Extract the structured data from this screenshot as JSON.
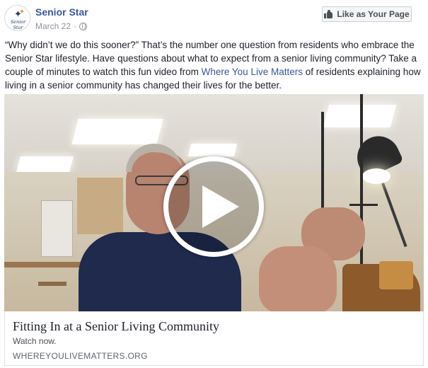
{
  "page": {
    "name": "Senior Star",
    "logo_text": "Senior Star",
    "date": "March 22",
    "separator": "·",
    "privacy_icon": "globe-icon"
  },
  "like_button": {
    "label": "Like as Your Page",
    "icon": "thumbs-up-icon"
  },
  "post": {
    "text_before_link": "“Why didn’t we do this sooner?” That’s the number one question from residents who embrace the Senior Star lifestyle. Have questions about what to expect from a senior living community? Take a couple of minutes to watch this fun video from ",
    "link_text": "Where You Live Matters",
    "text_after_link": " of residents explaining how living in a senior community has changed their lives for the better."
  },
  "video": {
    "play_icon": "play-icon"
  },
  "link_preview": {
    "title": "Fitting In at a Senior Living Community",
    "description": "Watch now.",
    "domain": "WHEREYOULIVEMATTERS.ORG"
  }
}
